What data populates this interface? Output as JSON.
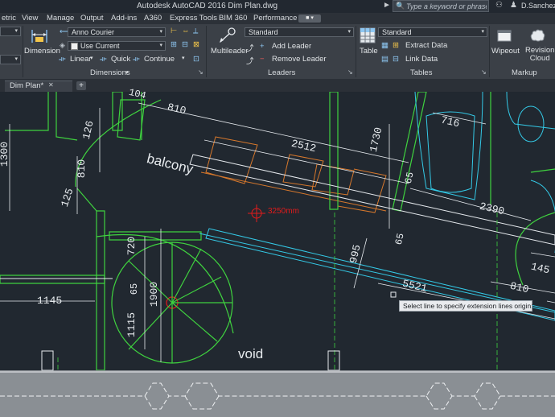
{
  "title_bar": {
    "title": "Autodesk AutoCAD 2016   Dim Plan.dwg",
    "search_placeholder": "Type a keyword or phrase",
    "user": "D.Sanchez"
  },
  "menu_tabs": [
    "etric",
    "View",
    "Manage",
    "Output",
    "Add-ins",
    "A360",
    "Express Tools",
    "BIM 360",
    "Performance"
  ],
  "ribbon": {
    "dimensions": {
      "dimension_label": "Dimension",
      "style_value": "Anno Courier",
      "layer_value": "Use Current",
      "linear_label": "Linear",
      "quick_label": "Quick",
      "continue_label": "Continue",
      "panel_title": "Dimensions"
    },
    "leaders": {
      "multileader_label": "Multileader",
      "style_value": "Standard",
      "add_leader_label": "Add Leader",
      "remove_leader_label": "Remove Leader",
      "panel_title": "Leaders"
    },
    "tables": {
      "table_label": "Table",
      "style_value": "Standard",
      "extract_data_label": "Extract Data",
      "link_data_label": "Link Data",
      "panel_title": "Tables"
    },
    "markup": {
      "wipeout_label": "Wipeout",
      "revision_cloud_label": "Revision\nCloud",
      "panel_title": "Markup"
    }
  },
  "file_tab": {
    "name": "Dim Plan*",
    "add_symbol": "+"
  },
  "drawing": {
    "room_labels": [
      "balcony",
      "void"
    ],
    "cursor_readout": "3250mm",
    "dimensions": [
      "810",
      "2512",
      "1730",
      "716",
      "65",
      "2390",
      "1300",
      "126",
      "810",
      "125",
      "995",
      "65",
      "5521",
      "1145",
      "720",
      "65",
      "1900",
      "1115",
      "810",
      "145",
      "104"
    ],
    "tooltip": "Select line to specify extension lines origin:"
  },
  "colors": {
    "canvas": "#212830",
    "ribbon": "#3b4047",
    "wall_green": "#3fd23f",
    "dim_white": "#e6eaee",
    "cyan": "#34c9e6",
    "orange": "#d7782c",
    "cursor_red": "#e31b1b"
  }
}
